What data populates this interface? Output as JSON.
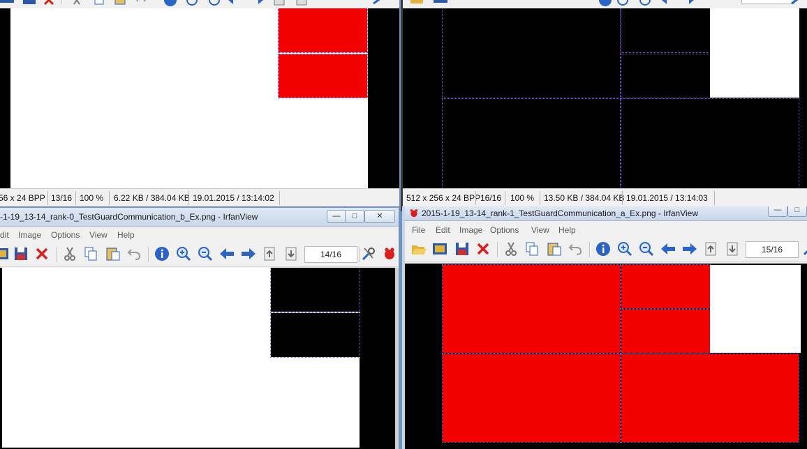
{
  "windows": {
    "top_left": {
      "status": [
        "56 x 24 BPP",
        "13/16",
        "100 %",
        "6.22 KB / 384.04 KB",
        "19.01.2015 / 13:14:02"
      ]
    },
    "top_right": {
      "status": [
        "512 x 256 x 24 BPP",
        "16/16",
        "100 %",
        "13.50 KB / 384.04 KB",
        "19.01.2015 / 13:14:03"
      ]
    },
    "bottom_left": {
      "title": "-1-19_13-14_rank-0_TestGuardCommunication_b_Ex.png - IrfanView",
      "menu": [
        "dit",
        "Image",
        "Options",
        "View",
        "Help"
      ],
      "page": "14/16"
    },
    "bottom_right": {
      "title": "2015-1-19_13-14_rank-1_TestGuardCommunication_a_Ex.png - IrfanView",
      "menu": [
        "File",
        "Edit",
        "Image",
        "Options",
        "View",
        "Help"
      ],
      "page": "15/16"
    }
  },
  "window_controls": {
    "minimize": "—",
    "maximize": "□",
    "close": "✕"
  },
  "colors": {
    "red": "#f20000",
    "black": "#000000",
    "white": "#ffffff",
    "desktop": "#6e93bf"
  },
  "icons": [
    "folder-open-icon",
    "slideshow-icon",
    "save-icon",
    "delete-icon",
    "cut-icon",
    "copy-icon",
    "paste-icon",
    "undo-icon",
    "info-icon",
    "zoom-in-icon",
    "zoom-out-icon",
    "previous-icon",
    "next-icon",
    "first-page-icon",
    "last-page-icon",
    "settings-icon",
    "irfanview-logo-icon"
  ]
}
